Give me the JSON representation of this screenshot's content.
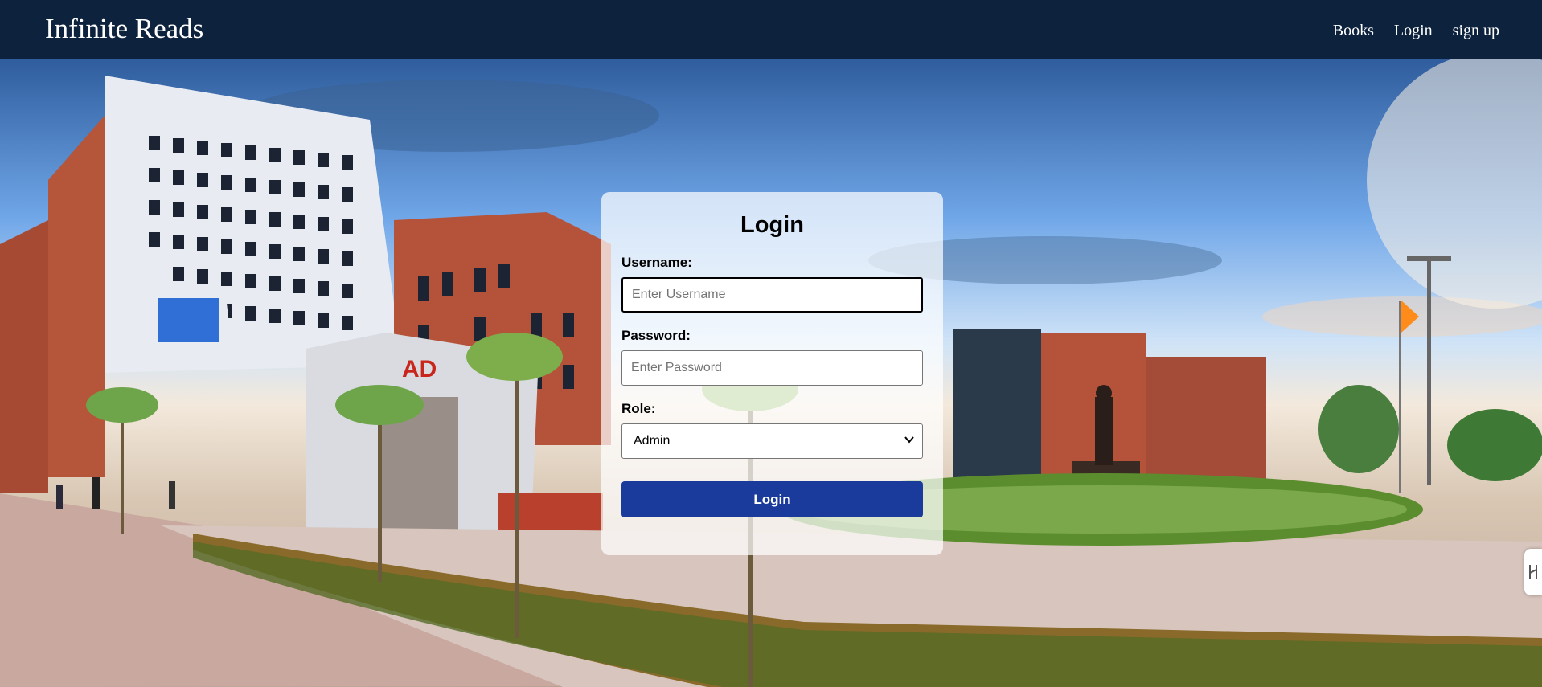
{
  "brand": "Infinite Reads",
  "nav": {
    "books": "Books",
    "login": "Login",
    "signup": "sign up"
  },
  "form": {
    "title": "Login",
    "username_label": "Username:",
    "username_placeholder": "Enter Username",
    "password_label": "Password:",
    "password_placeholder": "Enter Password",
    "role_label": "Role:",
    "role_selected": "Admin",
    "submit_label": "Login"
  },
  "colors": {
    "navbar": "#0d223d",
    "button": "#1a3a9c"
  },
  "icons": {
    "role_dropdown": "chevron-down-icon",
    "side_tab": "side-handle-icon"
  }
}
